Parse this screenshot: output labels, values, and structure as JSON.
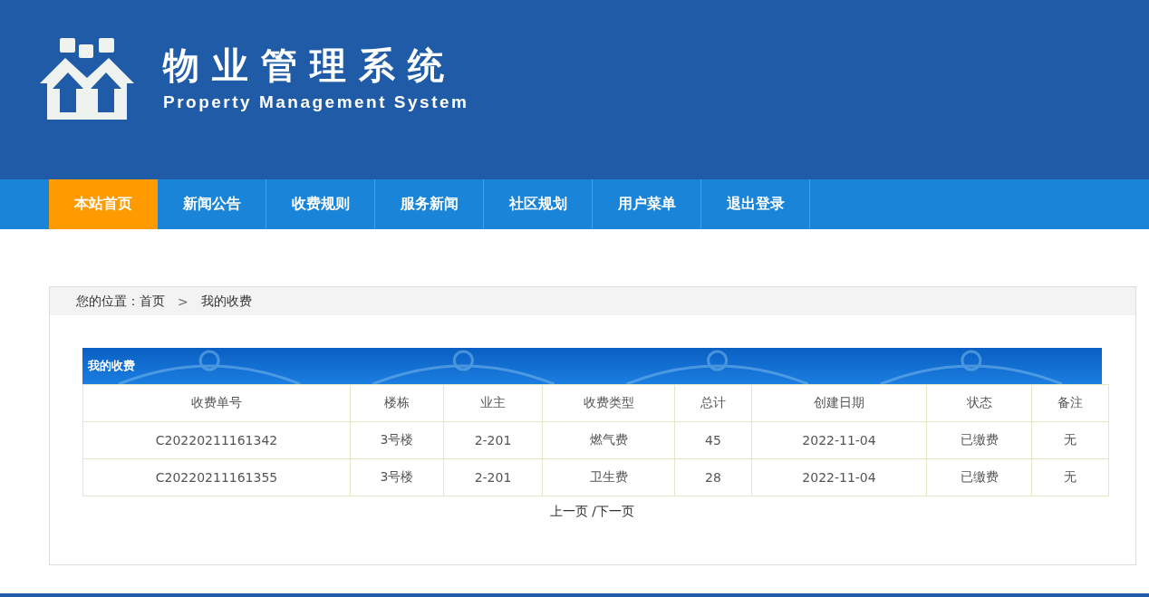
{
  "header": {
    "title": "物业管理系统",
    "subtitle": "Property Management System"
  },
  "nav": [
    {
      "label": "本站首页",
      "selected": true
    },
    {
      "label": "新闻公告",
      "selected": false
    },
    {
      "label": "收费规则",
      "selected": false
    },
    {
      "label": "服务新闻",
      "selected": false
    },
    {
      "label": "社区规划",
      "selected": false
    },
    {
      "label": "用户菜单",
      "selected": false
    },
    {
      "label": "退出登录",
      "selected": false
    }
  ],
  "breadcrumb": {
    "prefix": "您的位置：",
    "home": "首页",
    "separator": ">",
    "current": "我的收费"
  },
  "table": {
    "title": "我的收费",
    "columns": [
      "收费单号",
      "楼栋",
      "业主",
      "收费类型",
      "总计",
      "创建日期",
      "状态",
      "备注"
    ],
    "rows": [
      [
        "C20220211161342",
        "3号楼",
        "2-201",
        "燃气费",
        "45",
        "2022-11-04",
        "已缴费",
        "无"
      ],
      [
        "C20220211161355",
        "3号楼",
        "2-201",
        "卫生费",
        "28",
        "2022-11-04",
        "已缴费",
        "无"
      ]
    ]
  },
  "pagination": "上一页 /下一页"
}
